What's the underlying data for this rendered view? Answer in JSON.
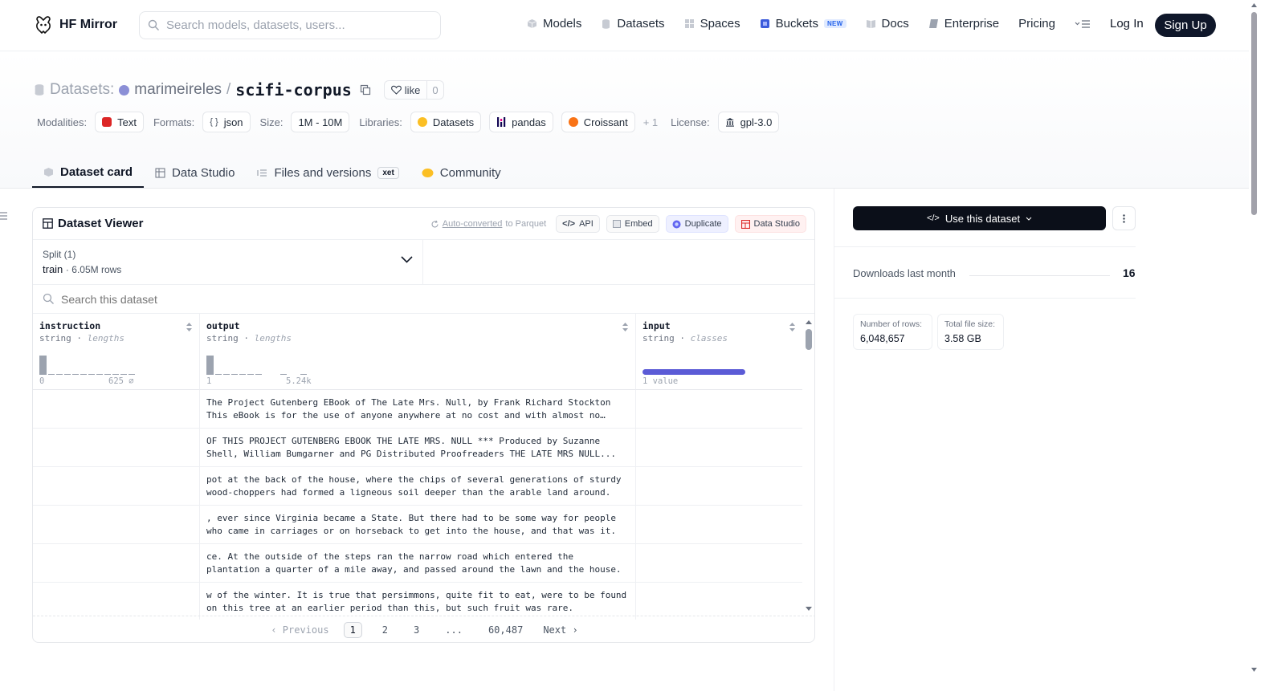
{
  "nav": {
    "brand": "HF Mirror",
    "search_placeholder": "Search models, datasets, users...",
    "links": [
      {
        "label": "Models",
        "icon": "cube-icon"
      },
      {
        "label": "Datasets",
        "icon": "database-icon"
      },
      {
        "label": "Spaces",
        "icon": "grid-icon"
      },
      {
        "label": "Buckets",
        "icon": "bucket-icon",
        "badge": "NEW"
      },
      {
        "label": "Docs",
        "icon": "book-icon"
      },
      {
        "label": "Enterprise",
        "icon": "enterprise-icon"
      },
      {
        "label": "Pricing"
      }
    ],
    "login": "Log In",
    "signup": "Sign Up"
  },
  "repo": {
    "prefix": "Datasets:",
    "owner": "marimeireles",
    "separator": "/",
    "name": "scifi-corpus",
    "like_label": "like",
    "like_count": "0"
  },
  "meta": {
    "modalities_label": "Modalities:",
    "modality": "Text",
    "formats_label": "Formats:",
    "format": "json",
    "size_label": "Size:",
    "size": "1M - 10M",
    "libraries_label": "Libraries:",
    "libraries": [
      "Datasets",
      "pandas",
      "Croissant"
    ],
    "more_libraries": "+ 1",
    "license_label": "License:",
    "license": "gpl-3.0"
  },
  "tabs": [
    {
      "label": "Dataset card",
      "active": true
    },
    {
      "label": "Data Studio"
    },
    {
      "label": "Files and versions",
      "badge": "xet"
    },
    {
      "label": "Community"
    }
  ],
  "viewer": {
    "title": "Dataset Viewer",
    "auto_converted_link": "Auto-converted",
    "auto_converted_rest": "to Parquet",
    "actions": [
      "API",
      "Embed",
      "Duplicate",
      "Data Studio"
    ],
    "split_label": "Split (1)",
    "split_name": "train",
    "split_rows": "6.05M rows",
    "search_placeholder": "Search this dataset",
    "columns": [
      {
        "name": "instruction",
        "type": "string",
        "stat": "lengths",
        "min": "0",
        "max": "625",
        "max_suffix": "⌀"
      },
      {
        "name": "output",
        "type": "string",
        "stat": "lengths",
        "min": "1",
        "max": "5.24k"
      },
      {
        "name": "input",
        "type": "string",
        "stat": "classes",
        "values_label": "1 value",
        "fraction": 1.0
      }
    ],
    "rows": [
      {
        "instruction": "",
        "output": "The Project Gutenberg EBook of The Late Mrs. Null, by Frank Richard Stockton This eBook is for the use of anyone anywhere at no cost and with almost no restrictions whatsoever.",
        "input": ""
      },
      {
        "instruction": "",
        "output": "OF THIS PROJECT GUTENBERG EBOOK THE LATE MRS. NULL *** Produced by Suzanne Shell, William Bumgarner and PG Distributed Proofreaders THE LATE MRS NULL...",
        "input": ""
      },
      {
        "instruction": "",
        "output": "pot at the back of the house, where the chips of several generations of sturdy wood-choppers had formed a ligneous soil deeper than the arable land around.",
        "input": ""
      },
      {
        "instruction": "",
        "output": ", ever since Virginia became a State. But there had to be some way for people who came in carriages or on horseback to get into the house, and that was it.",
        "input": ""
      },
      {
        "instruction": "",
        "output": "ce. At the outside of the steps ran the narrow road which entered the plantation a quarter of a mile away, and passed around the lawn and the house.",
        "input": ""
      },
      {
        "instruction": "",
        "output": "w of the winter. It is true that persimmons, quite fit to eat, were to be found on this tree at an earlier period than this, but such fruit was rare.",
        "input": ""
      }
    ],
    "pager": {
      "previous": "Previous",
      "pages": [
        "1",
        "2",
        "3",
        "...",
        "60,487"
      ],
      "current": "1",
      "next": "Next"
    }
  },
  "sidebar": {
    "use_button": "Use this dataset",
    "downloads_label": "Downloads last month",
    "downloads_value": "16",
    "rows_label": "Number of rows:",
    "rows_value": "6,048,657",
    "filesize_label": "Total file size:",
    "filesize_value": "3.58 GB"
  },
  "colors": {
    "accent_dark": "#0b0f19",
    "input_bar": "#5b5bd6",
    "hist_bar": "#9ca3af"
  }
}
